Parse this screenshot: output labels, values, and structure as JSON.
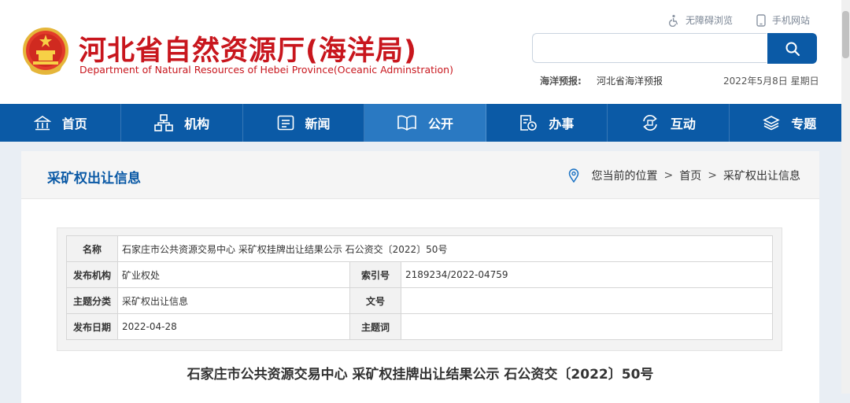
{
  "header": {
    "title": "河北省自然资源厅(海洋局)",
    "subtitle": "Department of Natural Resources of Hebei Province(Oceanic Adminstration)",
    "accessibility_link": "无障碍浏览",
    "mobile_link": "手机网站",
    "search": {
      "placeholder": "",
      "value": ""
    },
    "forecast_label": "海洋预报:",
    "forecast_link": "河北省海洋预报",
    "date": "2022年5月8日 星期日"
  },
  "nav": {
    "items": [
      {
        "label": "首页",
        "icon": "home-icon"
      },
      {
        "label": "机构",
        "icon": "org-icon"
      },
      {
        "label": "新闻",
        "icon": "news-icon"
      },
      {
        "label": "公开",
        "icon": "open-book-icon",
        "active": true
      },
      {
        "label": "办事",
        "icon": "service-icon"
      },
      {
        "label": "互动",
        "icon": "interact-icon"
      },
      {
        "label": "专题",
        "icon": "layers-icon"
      }
    ]
  },
  "panel": {
    "title": "采矿权出让信息",
    "breadcrumb": {
      "prefix": "您当前的位置",
      "items": [
        "首页",
        "采矿权出让信息"
      ],
      "separator": ">"
    }
  },
  "meta": {
    "name_label": "名称",
    "name_value": "石家庄市公共资源交易中心 采矿权挂牌出让结果公示 石公资交〔2022〕50号",
    "publisher_label": "发布机构",
    "publisher_value": "矿业权处",
    "index_label": "索引号",
    "index_value": "2189234/2022-04759",
    "category_label": "主题分类",
    "category_value": "采矿权出让信息",
    "docno_label": "文号",
    "docno_value": "",
    "date_label": "发布日期",
    "date_value": "2022-04-28",
    "keyword_label": "主题词",
    "keyword_value": ""
  },
  "doc_title": "石家庄市公共资源交易中心 采矿权挂牌出让结果公示 石公资交〔2022〕50号",
  "colors": {
    "brand_red": "#c8161d",
    "nav_blue": "#0b5aa6",
    "nav_active": "#2a79c2"
  }
}
